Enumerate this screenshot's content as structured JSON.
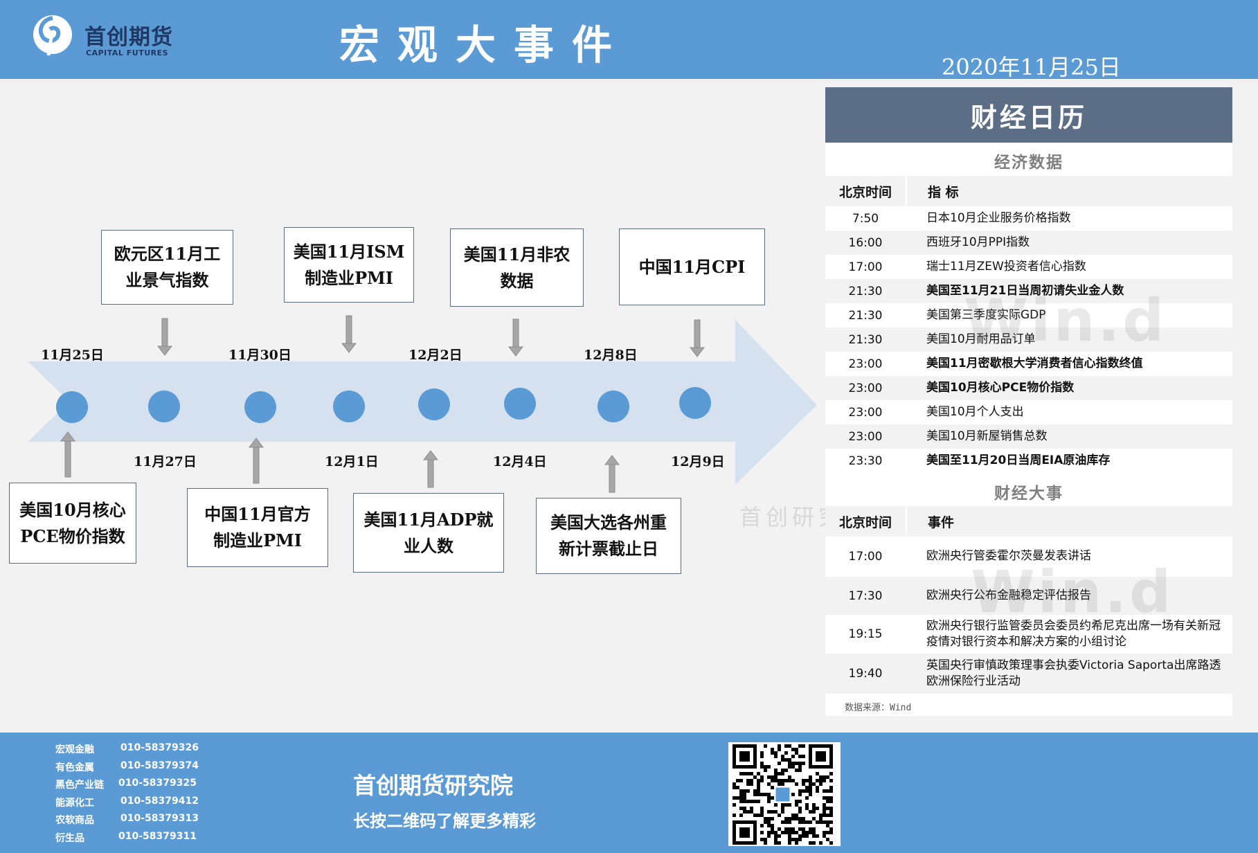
{
  "header": {
    "logo_cn": "首创期货",
    "logo_en": "CAPITAL FUTURES",
    "title": "宏观大事件",
    "date": "2020年11月25日"
  },
  "colors": {
    "brand_blue": "#5b9bd5",
    "panel_title": "#5b6e85",
    "dot_blue": "#5b9bd5",
    "arrow_fill": "#d6e1f0"
  },
  "timeline": {
    "dates_top": [
      "11月25日",
      "11月30日",
      "12月2日",
      "12月8日"
    ],
    "dates_bottom": [
      "11月27日",
      "12月1日",
      "12月4日",
      "12月9日"
    ],
    "events_top": [
      "欧元区11月工\n业景气指数",
      "美国11月ISM\n制造业PMI",
      "美国11月非农\n数据",
      "中国11月CPI"
    ],
    "events_bottom": [
      "美国10月核心\nPCE物价指数",
      "中国11月官方\n制造业PMI",
      "美国11月ADP就\n业人数",
      "美国大选各州重\n新计票截止日"
    ]
  },
  "calendar": {
    "title": "财经日历",
    "econ_section": "经济数据",
    "col_time": "北京时间",
    "col_indicator": "指  标",
    "econ_rows": [
      {
        "time": "7:50",
        "name": "日本10月企业服务价格指数",
        "bold": false
      },
      {
        "time": "16:00",
        "name": "西班牙10月PPI指数",
        "bold": false
      },
      {
        "time": "17:00",
        "name": "瑞士11月ZEW投资者信心指数",
        "bold": false
      },
      {
        "time": "21:30",
        "name": "美国至11月21日当周初请失业金人数",
        "bold": true
      },
      {
        "time": "21:30",
        "name": "美国第三季度实际GDP",
        "bold": false
      },
      {
        "time": "21:30",
        "name": "美国10月耐用品订单",
        "bold": false
      },
      {
        "time": "23:00",
        "name": "美国11月密歇根大学消费者信心指数终值",
        "bold": true
      },
      {
        "time": "23:00",
        "name": "美国10月核心PCE物价指数",
        "bold": true
      },
      {
        "time": "23:00",
        "name": "美国10月个人支出",
        "bold": false
      },
      {
        "time": "23:00",
        "name": "美国10月新屋销售总数",
        "bold": false
      },
      {
        "time": "23:30",
        "name": "美国至11月20日当周EIA原油库存",
        "bold": true
      }
    ],
    "events_section": "财经大事",
    "col_event": "事件",
    "event_rows": [
      {
        "time": "17:00",
        "name": "欧洲央行管委霍尔茨曼发表讲话"
      },
      {
        "time": "17:30",
        "name": "欧洲央行公布金融稳定评估报告"
      },
      {
        "time": "19:15",
        "name": "欧洲央行银行监管委员会委员约希尼克出席一场有关新冠疫情对银行资本和解决方案的小组讨论"
      },
      {
        "time": "19:40",
        "name": "英国央行审慎政策理事会执委Victoria Saporta出席路透欧洲保险行业活动"
      }
    ],
    "source": "数据来源：Wind"
  },
  "watermarks": {
    "wind": "Win.d",
    "capital": "首创研究"
  },
  "footer": {
    "contacts": [
      {
        "dept": "宏观金融",
        "phone": "010-58379326"
      },
      {
        "dept": "有色金属",
        "phone": "010-58379374"
      },
      {
        "dept": "黑色产业链",
        "phone": "010-58379325"
      },
      {
        "dept": "能源化工",
        "phone": "010-58379412"
      },
      {
        "dept": "农软商品",
        "phone": "010-58379313"
      },
      {
        "dept": "衍生品",
        "phone": "010-58379311"
      }
    ],
    "name": "首创期货研究院",
    "slogan": "长按二维码了解更多精彩"
  }
}
